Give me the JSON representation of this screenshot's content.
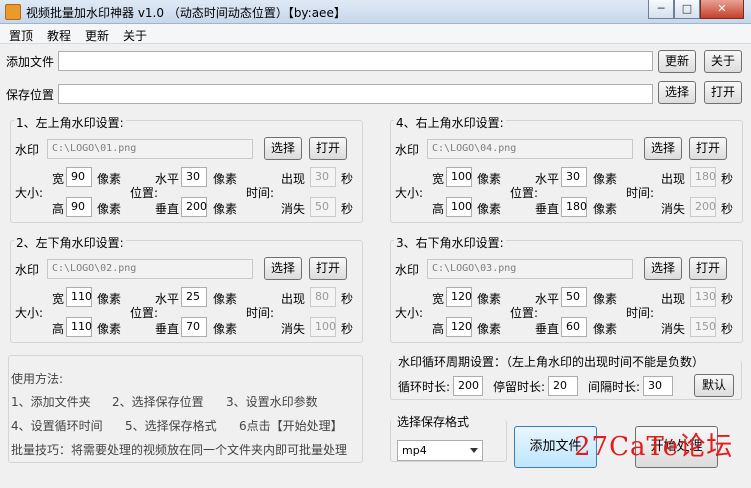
{
  "window": {
    "title": "视频批量加水印神器 v1.0 （动态时间动态位置）【by:aee】",
    "min": "─",
    "max": "□",
    "close": "✕"
  },
  "menu": [
    "置顶",
    "教程",
    "更新",
    "关于"
  ],
  "files": {
    "add_label": "添加文件",
    "add_value": "",
    "update_btn": "更新",
    "about_btn": "关于",
    "save_label": "保存位置",
    "save_value": "",
    "choose_btn": "选择",
    "open_btn": "打开"
  },
  "common": {
    "wm_label": "水印",
    "size_label": "大小:",
    "pos_label": "位置:",
    "time_label": "时间:",
    "w_label": "宽",
    "h_label": "高",
    "px": "像素",
    "hz_label": "水平",
    "vt_label": "垂直",
    "appear_label": "出现",
    "vanish_label": "消失",
    "sec": "秒",
    "choose_btn": "选择",
    "open_btn": "打开"
  },
  "panels": {
    "tl": {
      "title": "1、左上角水印设置:",
      "path": "C:\\LOGO\\01.png",
      "w": "90",
      "h": "90",
      "x": "30",
      "y": "200",
      "appear": "30",
      "vanish": "50"
    },
    "tr": {
      "title": "4、右上角水印设置:",
      "path": "C:\\LOGO\\04.png",
      "w": "100",
      "h": "100",
      "x": "30",
      "y": "180",
      "appear": "180",
      "vanish": "200"
    },
    "bl": {
      "title": "2、左下角水印设置:",
      "path": "C:\\LOGO\\02.png",
      "w": "110",
      "h": "110",
      "x": "25",
      "y": "70",
      "appear": "80",
      "vanish": "100"
    },
    "br": {
      "title": "3、右下角水印设置:",
      "path": "C:\\LOGO\\03.png",
      "w": "120",
      "h": "120",
      "x": "50",
      "y": "60",
      "appear": "130",
      "vanish": "150"
    }
  },
  "help": {
    "title": "使用方法:",
    "step1": "1、添加文件夹",
    "step2": "2、选择保存位置",
    "step3": "3、设置水印参数",
    "step4": "4、设置循环时间",
    "step5": "5、选择保存格式",
    "step6": "6点击【开始处理】",
    "tip": "批量技巧：将需要处理的视频放在同一个文件夹内即可批量处理"
  },
  "cycle": {
    "title": "水印循环周期设置：（左上角水印的出现时间不能是负数）",
    "loop_label": "循环时长:",
    "loop_value": "200",
    "stay_label": "停留时长:",
    "stay_value": "20",
    "gap_label": "间隔时长:",
    "gap_value": "30",
    "default_btn": "默认"
  },
  "format": {
    "title": "选择保存格式",
    "value": "mp4"
  },
  "actions": {
    "add_file": "添加文件",
    "start": "开始处理"
  },
  "watermark": "27CaTe论坛"
}
